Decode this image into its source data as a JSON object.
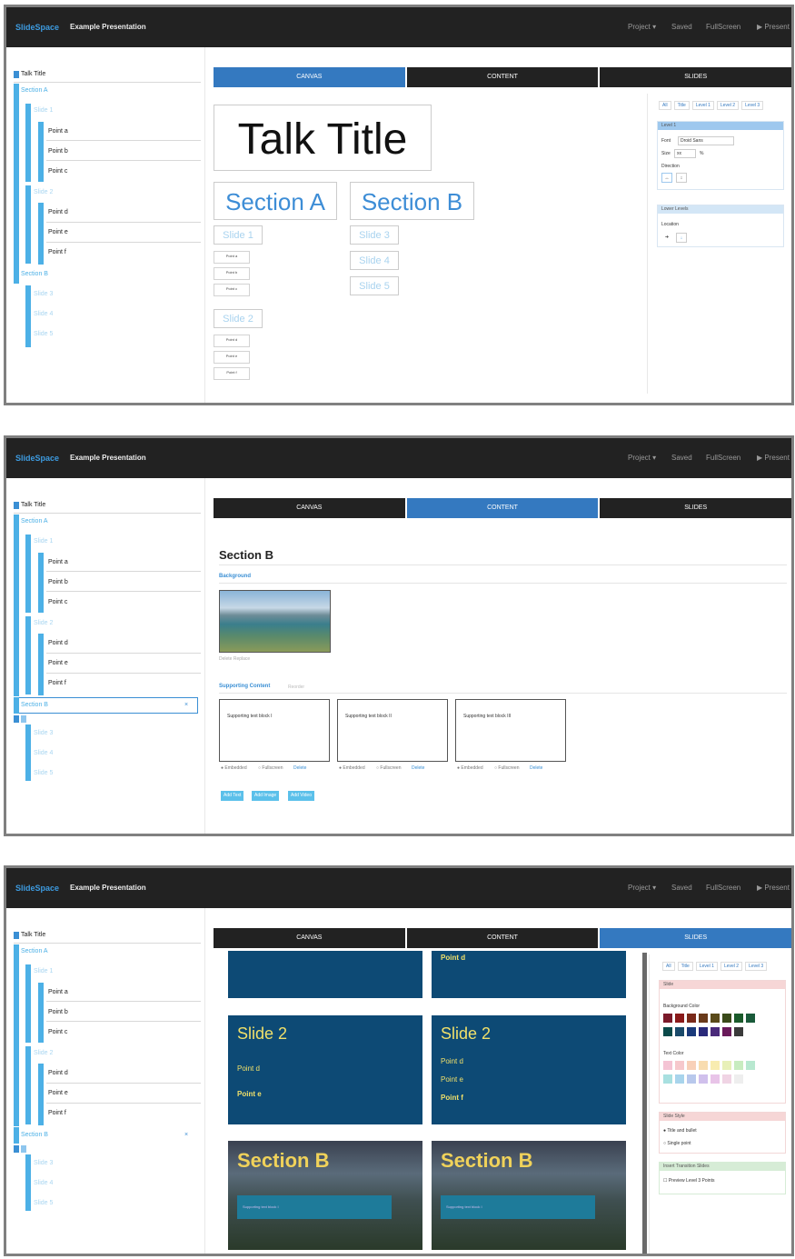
{
  "app": {
    "brand": "SlideSpace",
    "title": "Example Presentation"
  },
  "nav": {
    "project": "Project ▾",
    "saved": "Saved",
    "fullscreen": "FullScreen",
    "present": "▶ Present"
  },
  "tabs": [
    "CANVAS",
    "CONTENT",
    "SLIDES"
  ],
  "tree": {
    "talk_title": "Talk Title",
    "section_a": "Section A",
    "slide1": "Slide 1",
    "point_a": "Point a",
    "point_b": "Point b",
    "point_c": "Point c",
    "slide2": "Slide 2",
    "point_d": "Point d",
    "point_e": "Point e",
    "point_f": "Point f",
    "section_b": "Section B",
    "slide3": "Slide 3",
    "slide4": "Slide 4",
    "slide5": "Slide 5",
    "close": "×"
  },
  "canvas": {
    "talk_title": "Talk Title",
    "section_a": "Section A",
    "section_b": "Section B",
    "slide1": "Slide 1",
    "slide2": "Slide 2",
    "slide3": "Slide 3",
    "slide4": "Slide 4",
    "slide5": "Slide 5",
    "point_a": "Point a",
    "point_b": "Point b",
    "point_c": "Point c",
    "point_d": "Point d",
    "point_e": "Point e",
    "point_f": "Point f"
  },
  "levels": [
    "All",
    "Title",
    "Level 1",
    "Level 2",
    "Level 3"
  ],
  "format": {
    "level1": "Level 1",
    "font_label": "Font",
    "font_value": "Droid Sans",
    "size_label": "Size",
    "size_value": "xx",
    "size_unit": "%",
    "direction_label": "Direction",
    "lower_levels": "Lower Levels",
    "location_label": "Location"
  },
  "content": {
    "heading": "Section B",
    "background": "Background",
    "bg_actions": "Delete Replace",
    "supporting": "Supporting Content",
    "reorder": "Reorder",
    "blocks": [
      "Supporting text block I",
      "Supporting text block II",
      "Supporting text block III"
    ],
    "embedded": "● Embedded",
    "fullscreen": "○ Fullscreen",
    "delete": "Delete",
    "add_text": "Add Text",
    "add_image": "Add Image",
    "add_video": "Add Video"
  },
  "slides": {
    "slide2": "Slide 2",
    "point_d": "Point d",
    "point_e": "Point e",
    "point_f": "Point f",
    "section_b": "Section B",
    "supporting": "Supporting text block I",
    "slide_card": "Slide",
    "bg_color": "Background Color",
    "text_color": "Text Color",
    "slide_style": "Slide Style",
    "style_title": "● Title and bullet",
    "style_single": "○ Single point",
    "insert_transition": "Insert Transition Slides",
    "preview_level3": "☐ Preview Level 3 Points"
  },
  "colors": {
    "bg_swatches": [
      "#7a1a2a",
      "#8a1a1a",
      "#7a2a1a",
      "#6a3a1a",
      "#5a4a1a",
      "#3a4a1a",
      "#1a5a2a",
      "#1a5a3a",
      "#0a4a4a",
      "#1a4a6a",
      "#1a3a7a",
      "#2a2a7a",
      "#4a2a7a",
      "#6a1a5a",
      "#3a3a3a"
    ],
    "text_swatches": [
      "#f4c4d4",
      "#f6c8cc",
      "#f8d0b8",
      "#f8dcb0",
      "#f8ecb0",
      "#e8f0b8",
      "#c8ecc0",
      "#b8e8d0",
      "#a8e0e0",
      "#a8d4ec",
      "#b8c8ec",
      "#d0c0ec",
      "#e8c4e8",
      "#f0d4e4",
      "#eeeeee"
    ]
  }
}
